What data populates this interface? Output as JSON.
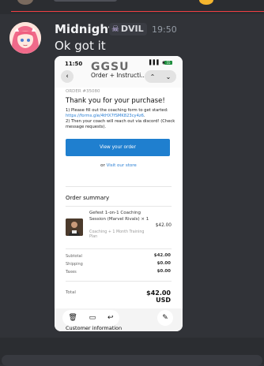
{
  "message": {
    "username": "Midnight",
    "tag": "DVIL",
    "timestamp": "19:50",
    "content": "Ok got it"
  },
  "screenshot": {
    "status_time": "11:50",
    "status_icons": "▌▌▌ ◉",
    "battery": "55",
    "logo": "GGSU",
    "nav_title": "Order + Instructi...",
    "order_number": "ORDER #35080",
    "thanks": "Thank you for your purchase!",
    "step1_prefix": "1) Please fill out the coaching form to get started: ",
    "step1_link": "https://forms.gle/4tHX7fSMK823cy4z6",
    "step1_suffix": ".",
    "step2": "2) Then your coach will reach out via discord! (Check message requests).",
    "view_order_label": "View your order",
    "or_text": "or",
    "visit_store": "Visit our store",
    "summary_title": "Order summary",
    "product": {
      "name": "Gefest 1-on-1 Coaching Session (Marvel Rivals) × 1",
      "subtitle": "Coaching + 1 Month Training Plan",
      "price": "$42.00"
    },
    "subtotal_label": "Subtotal",
    "subtotal_value": "$42.00",
    "shipping_label": "Shipping",
    "shipping_value": "$0.00",
    "taxes_label": "Taxes",
    "taxes_value": "$0.00",
    "total_label": "Total",
    "total_value": "$42.00 USD",
    "customer_info": "Customer information"
  }
}
